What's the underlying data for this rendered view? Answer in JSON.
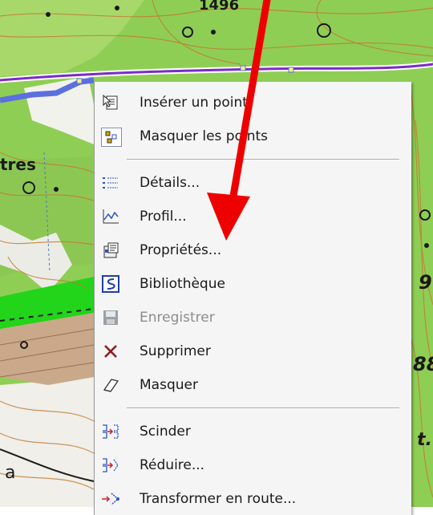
{
  "map": {
    "label_top": "1496",
    "label_left": "tres",
    "label_right_top": "9",
    "label_right_mid": "88",
    "label_bottom_left": "a",
    "label_right_low": "t."
  },
  "menu": {
    "items": [
      {
        "label": "Insérer un point",
        "icon": "insert-point-icon",
        "enabled": true
      },
      {
        "label": "Masquer les points",
        "icon": "hide-points-icon",
        "enabled": true
      },
      {
        "label": "Détails...",
        "icon": "details-icon",
        "enabled": true
      },
      {
        "label": "Profil...",
        "icon": "profile-icon",
        "enabled": true
      },
      {
        "label": "Propriétés...",
        "icon": "properties-icon",
        "enabled": true
      },
      {
        "label": "Bibliothèque",
        "icon": "library-icon",
        "enabled": true
      },
      {
        "label": "Enregistrer",
        "icon": "save-icon",
        "enabled": false
      },
      {
        "label": "Supprimer",
        "icon": "delete-icon",
        "enabled": true
      },
      {
        "label": "Masquer",
        "icon": "hide-eraser-icon",
        "enabled": true
      },
      {
        "label": "Scinder",
        "icon": "split-icon",
        "enabled": true
      },
      {
        "label": "Réduire...",
        "icon": "reduce-icon",
        "enabled": true
      },
      {
        "label": "Transformer en route...",
        "icon": "transform-route-icon",
        "enabled": true
      }
    ]
  },
  "colors": {
    "annotation_arrow": "#ee0000",
    "track": "#5b6fe0",
    "map_green": "#8fce55",
    "delete_x": "#8b1a1a"
  }
}
